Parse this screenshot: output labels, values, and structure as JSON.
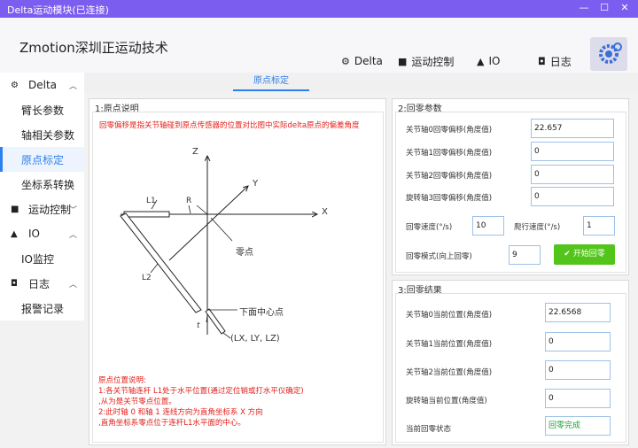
{
  "window": {
    "title": "Delta运动模块(已连接)",
    "min": "—",
    "max": "☐",
    "close": "✕"
  },
  "header": {
    "brand": "Zmotion深圳正运动技术",
    "nav": [
      {
        "icon": "gear-icon",
        "label": "Delta"
      },
      {
        "icon": "windows-icon",
        "label": "运动控制"
      },
      {
        "icon": "chart-icon",
        "label": "IO"
      },
      {
        "icon": "camera-icon",
        "label": "日志"
      }
    ]
  },
  "sidebar": {
    "groups": [
      {
        "label": "Delta",
        "items": [
          "臂长参数",
          "轴相关参数",
          "原点标定",
          "坐标系转换"
        ]
      },
      {
        "label": "运动控制",
        "items": []
      },
      {
        "label": "IO",
        "items": [
          "IO监控"
        ]
      },
      {
        "label": "日志",
        "items": [
          "报警记录"
        ]
      }
    ],
    "active": "原点标定"
  },
  "tab": {
    "label": "原点标定"
  },
  "left_panel": {
    "title": "1:原点说明",
    "description": "回零偏移是指关节轴碰到原点传感器的位置对比图中实际delta原点的偏差角度",
    "diagram": {
      "z": "Z",
      "y": "Y",
      "x": "X",
      "r": "R",
      "l1": "L1",
      "l2": "L2",
      "t": "t",
      "zero": "零点",
      "bottom_center": "下面中心点",
      "coords": "(LX, LY, LZ)"
    },
    "notes": [
      "原点位置说明:",
      "1:各关节轴连杆 L1处于水平位置(通过定位销或打水平仪确定)",
      ",从为是关节零点位置。",
      "2:此时轴 0 和轴 1 连线方向为直角坐标系 X 方向",
      ",直角坐标系零点位于连杆L1水平面的中心。"
    ]
  },
  "homing_params": {
    "title": "2:回零参数",
    "rows": [
      {
        "label": "关节轴0回零偏移(角度值)",
        "value": "22.657"
      },
      {
        "label": "关节轴1回零偏移(角度值)",
        "value": "0"
      },
      {
        "label": "关节轴2回零偏移(角度值)",
        "value": "0"
      },
      {
        "label": "旋转轴3回零偏移(角度值)",
        "value": "0"
      }
    ],
    "speed_label": "回零速度(°/s)",
    "speed_value": "10",
    "creep_label": "爬行速度(°/s)",
    "creep_value": "1",
    "mode_label": "回零模式(向上回零)",
    "mode_value": "9",
    "start_button": "开始回零"
  },
  "homing_result": {
    "title": "3:回零结果",
    "rows": [
      {
        "label": "关节轴0当前位置(角度值)",
        "value": "22.6568"
      },
      {
        "label": "关节轴1当前位置(角度值)",
        "value": "0"
      },
      {
        "label": "关节轴2当前位置(角度值)",
        "value": "0"
      },
      {
        "label": "旋转轴当前位置(角度值)",
        "value": "0"
      }
    ],
    "status_label": "当前回零状态",
    "status_value": "回零完成"
  },
  "colors": {
    "titlebar": "#7b5ef0",
    "accent": "#2d7ff0",
    "note_red": "#e3201b",
    "button_green": "#52c41a",
    "status_green": "#1d9e3a"
  }
}
